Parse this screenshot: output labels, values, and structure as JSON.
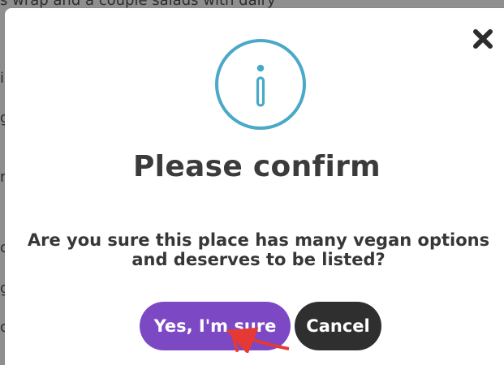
{
  "background": {
    "top_line": "s wrap and a couple salads with dairy",
    "fragments": [
      "i",
      "g",
      "r",
      "c",
      "g",
      "c"
    ]
  },
  "modal": {
    "title": "Please confirm",
    "message": "Are you sure this place has many vegan options and deserves to be listed?",
    "yes_label": "Yes, I'm sure",
    "cancel_label": "Cancel",
    "icons": {
      "info": "info-icon",
      "close": "close-icon"
    },
    "colors": {
      "accent": "#4aa8c9",
      "primary_button": "#7d48c4",
      "secondary_button": "#2f2f2f",
      "annotation_arrow": "#e53935"
    }
  }
}
